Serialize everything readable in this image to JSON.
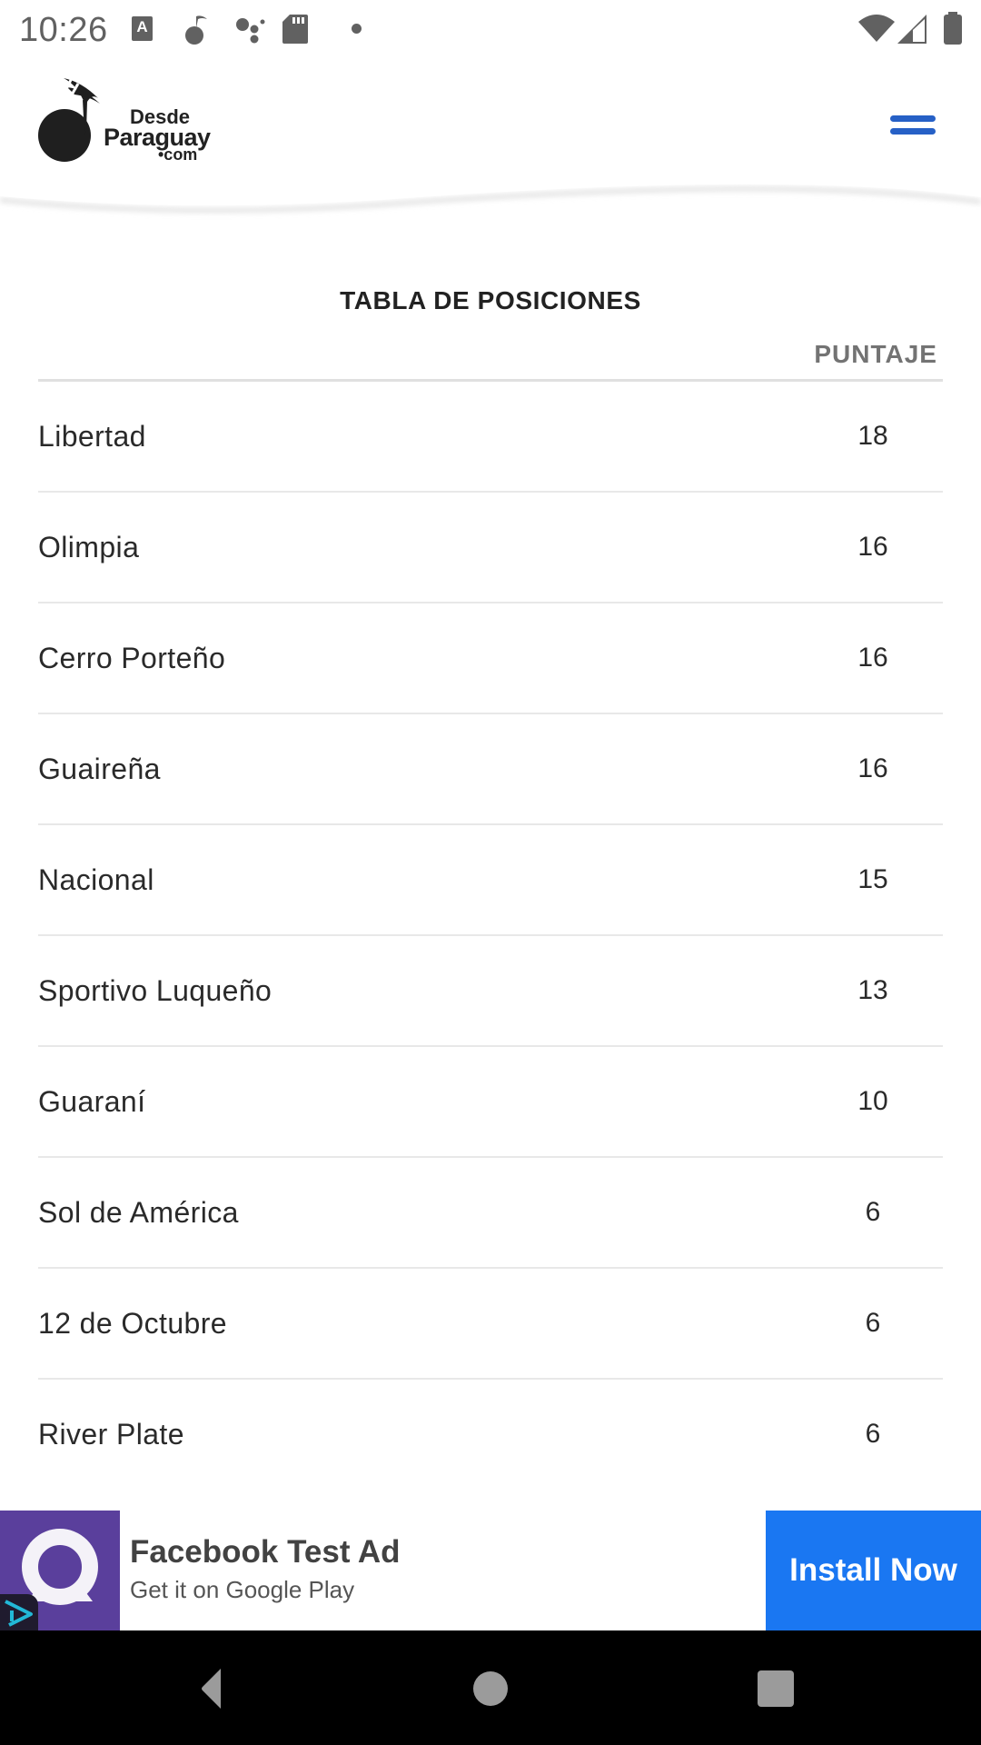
{
  "status_bar": {
    "time": "10:26",
    "notification_icons": [
      "keyboard-a-icon",
      "music-note-icon",
      "assistant-dots-icon",
      "sd-card-icon",
      "dot-icon"
    ],
    "system_icons": [
      "wifi-icon",
      "cellular-signal-icon",
      "battery-icon"
    ],
    "keyboard_glyph": "A"
  },
  "header": {
    "logo": {
      "line1": "Desde",
      "line2": "Paraguay",
      "line3": "•com"
    },
    "menu_icon": "hamburger-menu-icon",
    "accent_color": "#2660c6"
  },
  "standings": {
    "title": "TABLA DE POSICIONES",
    "score_header": "PUNTAJE",
    "rows": [
      {
        "team": "Libertad",
        "points": "18"
      },
      {
        "team": "Olimpia",
        "points": "16"
      },
      {
        "team": "Cerro Porteño",
        "points": "16"
      },
      {
        "team": "Guaireña",
        "points": "16"
      },
      {
        "team": "Nacional",
        "points": "15"
      },
      {
        "team": "Sportivo Luqueño",
        "points": "13"
      },
      {
        "team": "Guaraní",
        "points": "10"
      },
      {
        "team": "Sol de América",
        "points": "6"
      },
      {
        "team": "12 de Octubre",
        "points": "6"
      },
      {
        "team": "River Plate",
        "points": "6"
      }
    ]
  },
  "ad": {
    "title": "Facebook Test Ad",
    "subtitle": "Get it on Google Play",
    "cta": "Install Now",
    "icon_color": "#5a3f9c",
    "cta_color": "#1a77f2"
  },
  "nav_bar": {
    "buttons": [
      "back-icon",
      "home-icon",
      "recents-icon"
    ]
  }
}
